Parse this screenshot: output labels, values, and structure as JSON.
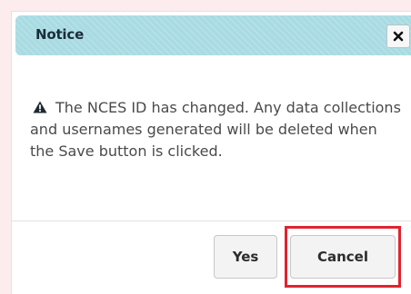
{
  "background_color": "#fdecee",
  "dialog": {
    "title": "Notice",
    "close_icon": "close-icon",
    "warning_icon": "warning-icon",
    "message": "The NCES ID has changed. Any data collections and usernames generated will be deleted when the Save button is clicked.",
    "buttons": {
      "yes_label": "Yes",
      "cancel_label": "Cancel"
    },
    "highlight_color": "#e0242f",
    "titlebar_color": "#a9dbe3"
  }
}
